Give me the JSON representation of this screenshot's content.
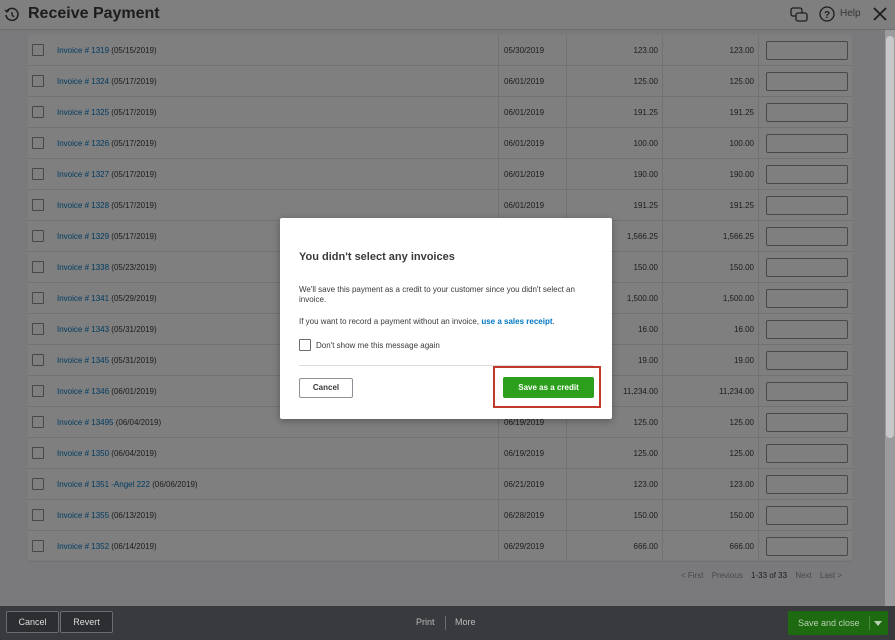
{
  "header": {
    "title": "Receive Payment",
    "help_label": "Help"
  },
  "rows": [
    {
      "invoice": "Invoice # 1319",
      "date": "(05/15/2019)",
      "due": "05/30/2019",
      "original": "123.00",
      "open": "123.00"
    },
    {
      "invoice": "Invoice # 1324",
      "date": "(05/17/2019)",
      "due": "06/01/2019",
      "original": "125.00",
      "open": "125.00"
    },
    {
      "invoice": "Invoice # 1325",
      "date": "(05/17/2019)",
      "due": "06/01/2019",
      "original": "191.25",
      "open": "191.25"
    },
    {
      "invoice": "Invoice # 1326",
      "date": "(05/17/2019)",
      "due": "06/01/2019",
      "original": "100.00",
      "open": "100.00"
    },
    {
      "invoice": "Invoice # 1327",
      "date": "(05/17/2019)",
      "due": "06/01/2019",
      "original": "190.00",
      "open": "190.00"
    },
    {
      "invoice": "Invoice # 1328",
      "date": "(05/17/2019)",
      "due": "06/01/2019",
      "original": "191.25",
      "open": "191.25"
    },
    {
      "invoice": "Invoice # 1329",
      "date": "(05/17/2019)",
      "due": "",
      "original": "1,566.25",
      "open": "1,566.25"
    },
    {
      "invoice": "Invoice # 1338",
      "date": "(05/23/2019)",
      "due": "",
      "original": "150.00",
      "open": "150.00"
    },
    {
      "invoice": "Invoice # 1341",
      "date": "(05/29/2019)",
      "due": "",
      "original": "1,500.00",
      "open": "1,500.00"
    },
    {
      "invoice": "Invoice # 1343",
      "date": "(05/31/2019)",
      "due": "",
      "original": "16.00",
      "open": "16.00"
    },
    {
      "invoice": "Invoice # 1345",
      "date": "(05/31/2019)",
      "due": "",
      "original": "19.00",
      "open": "19.00"
    },
    {
      "invoice": "Invoice # 1346",
      "date": "(06/01/2019)",
      "due": "",
      "original": "11,234.00",
      "open": "11,234.00"
    },
    {
      "invoice": "Invoice # 13495",
      "date": "(06/04/2019)",
      "due": "06/19/2019",
      "original": "125.00",
      "open": "125.00"
    },
    {
      "invoice": "Invoice # 1350",
      "date": "(06/04/2019)",
      "due": "06/19/2019",
      "original": "125.00",
      "open": "125.00"
    },
    {
      "invoice": "Invoice # 1351 -Angel 222",
      "date": "(06/06/2019)",
      "due": "06/21/2019",
      "original": "123.00",
      "open": "123.00"
    },
    {
      "invoice": "Invoice # 1355",
      "date": "(06/13/2019)",
      "due": "06/28/2019",
      "original": "150.00",
      "open": "150.00"
    },
    {
      "invoice": "Invoice # 1352",
      "date": "(06/14/2019)",
      "due": "06/29/2019",
      "original": "666.00",
      "open": "666.00"
    }
  ],
  "pager": {
    "first": "< First",
    "previous": "Previous",
    "range": "1-33 of 33",
    "next": "Next",
    "last": "Last >"
  },
  "footer": {
    "cancel": "Cancel",
    "revert": "Revert",
    "print": "Print",
    "more": "More",
    "save_close": "Save and close"
  },
  "dialog": {
    "title": "You didn't select any invoices",
    "body1": "We'll save this payment as a credit to your customer since you didn't select an invoice.",
    "body2_prefix": "If you want to record a payment without an invoice,",
    "body2_link": "use a sales receipt",
    "body2_suffix": ".",
    "checkbox_label": "Don't show me this message again",
    "cancel": "Cancel",
    "save_credit": "Save as a credit"
  },
  "colors": {
    "link": "#0077c5",
    "primary_green": "#2ca01c",
    "highlight": "#c0392b"
  }
}
